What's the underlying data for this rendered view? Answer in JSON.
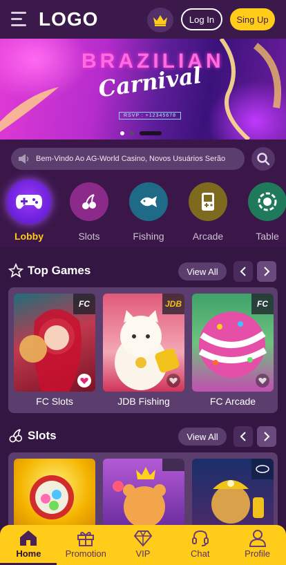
{
  "header": {
    "logo": "LOGO",
    "login_label": "Log In",
    "signup_label": "Sing Up",
    "crown_icon": "crown-icon"
  },
  "banner": {
    "title": "BRAZILIAN",
    "subtitle": "Carnival",
    "tag": "RSVP : +12345678",
    "slide_count": 3,
    "active_slide": 1
  },
  "marquee": {
    "text": "Bem-Vindo Ao AG-World Casino, Novos Usuários Serão",
    "icon": "speaker-icon"
  },
  "categories": [
    {
      "label": "Lobby",
      "icon": "gamepad-icon",
      "color": "#7a2be0",
      "active": true
    },
    {
      "label": "Slots",
      "icon": "cherries-icon",
      "color": "#8c2a8a"
    },
    {
      "label": "Fishing",
      "icon": "fish-icon",
      "color": "#1f6a87"
    },
    {
      "label": "Arcade",
      "icon": "arcade-icon",
      "color": "#7e6a1f"
    },
    {
      "label": "Table",
      "icon": "chip-icon",
      "color": "#1e7a5a"
    }
  ],
  "top_games": {
    "title": "Top Games",
    "view_all": "View All",
    "games": [
      {
        "name": "FC Slots",
        "provider": "FC",
        "favorite": true
      },
      {
        "name": "JDB Fishing",
        "provider": "JDB",
        "favorite": false
      },
      {
        "name": "FC Arcade",
        "provider": "FC",
        "favorite": false
      }
    ]
  },
  "slots": {
    "title": "Slots",
    "view_all": "View All"
  },
  "bottom_nav": [
    {
      "label": "Home",
      "icon": "home-icon",
      "active": true
    },
    {
      "label": "Promotion",
      "icon": "gift-icon"
    },
    {
      "label": "VIP",
      "icon": "diamond-icon"
    },
    {
      "label": "Chat",
      "icon": "headset-icon"
    },
    {
      "label": "Profile",
      "icon": "user-icon"
    }
  ],
  "colors": {
    "accent": "#ffcc1a",
    "background": "#3a1748",
    "card": "#5b3d6e"
  }
}
